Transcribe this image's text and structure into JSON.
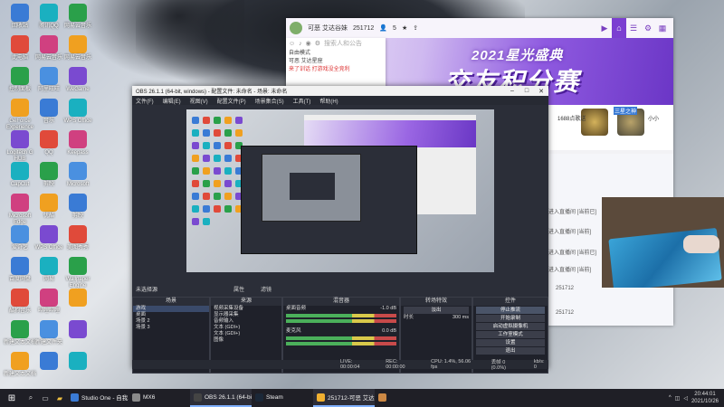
{
  "desktop": {
    "icons_col1": [
      "回收站",
      "此电脑",
      "控制面板",
      "GeForce Experience",
      "Logitech G HUB",
      "CapCut",
      "Microsoft Edge",
      "爱奇艺",
      "百度网盘",
      "酷狗音乐",
      "新建文本文档",
      "新建文本文档"
    ],
    "icons_col2": [
      "腾讯QQ",
      "网易云音乐",
      "阿里旺旺",
      "音乐",
      "QQ",
      "剪映",
      "优酷",
      "WPS Office",
      "网易",
      "哔哩哔哩",
      "新建文件夹",
      ""
    ],
    "icons_col3": [
      "网易云音乐",
      "网易云音乐",
      "WeGame",
      "WPS Office",
      "Keepass",
      "Microsoft",
      "剪映",
      "美图秀秀",
      "Wallpaper Engine",
      "",
      "",
      ""
    ]
  },
  "huya": {
    "room_id": "251712",
    "anchor": "可恶 艾达谷妹",
    "fans": "5",
    "search_placeholder": "搜索人和公告",
    "panel_title": "自由模式",
    "panel_line1": "可恶 艾达星座",
    "panel_line2": "来了训话 打游戏没全竞利",
    "banner_small": "2021星光盛典",
    "banner_big": "交友积分赛",
    "gift1": "1688点歌送",
    "gift2": "三星之神",
    "gift3": "小小",
    "chat_lines": [
      "进入直播间 [当前已]",
      "进入直播间 [当前]",
      "进入直播间 [当前已]",
      "进入直播间 [当前]"
    ],
    "chat_user1": "251712",
    "chat_user2": "251712",
    "nav_icons": [
      "video-icon",
      "home-icon",
      "list-icon",
      "game-icon",
      "grid-icon"
    ]
  },
  "obs": {
    "title": "OBS 26.1.1 (64-bit, windows) - 配置文件: 未命名 - 场景: 未命名",
    "menu": [
      "文件(F)",
      "编辑(E)",
      "视图(V)",
      "配置文件(P)",
      "场景集合(S)",
      "工具(T)",
      "帮助(H)"
    ],
    "docks": {
      "scenes": {
        "title": "场景",
        "items": [
          "游戏",
          "桌面",
          "场景 2",
          "场景 3"
        ]
      },
      "sources": {
        "title": "来源",
        "items": [
          "视频采集设备",
          "显示器采集",
          "音频输入",
          "文本 (GDI+)",
          "文本 (GDI+)",
          "图像"
        ]
      },
      "mixer": {
        "title": "混音器",
        "ch1": "桌面音频",
        "ch2": "麦克风",
        "db1": "-1.0 dB",
        "db2": "0.0 dB"
      },
      "transitions": {
        "title": "转场特效",
        "type": "淡出",
        "duration_label": "时长",
        "duration": "300 ms"
      },
      "controls": {
        "title": "控件",
        "buttons": [
          "停止推流",
          "开始录制",
          "启动虚拟摄像机",
          "工作室模式",
          "设置",
          "退出"
        ]
      }
    },
    "scene_panel_label": "未选择源",
    "props_label": "属性",
    "filters_label": "滤镜",
    "status": {
      "live": "LIVE: 00:00:04",
      "rec": "REC: 00:00:00",
      "cpu": "CPU: 1.4%, 56.06 fps",
      "drop": "丢帧 0 (0.0%)",
      "kbps": "kb/s: 0"
    }
  },
  "taskbar": {
    "apps": [
      {
        "label": "Studio One - 自我...",
        "color": "#3a7bd5"
      },
      {
        "label": "MX6",
        "color": "#8a8a8a"
      },
      {
        "label": "OBS 26.1.1 (64-bi...",
        "color": "#444"
      },
      {
        "label": "Steam",
        "color": "#1b2838"
      },
      {
        "label": "251712-可恶 艾达...",
        "color": "#f0b030"
      },
      {
        "label": "",
        "color": "#c84"
      }
    ],
    "time": "20:44:01",
    "date": "2021/10/26"
  }
}
